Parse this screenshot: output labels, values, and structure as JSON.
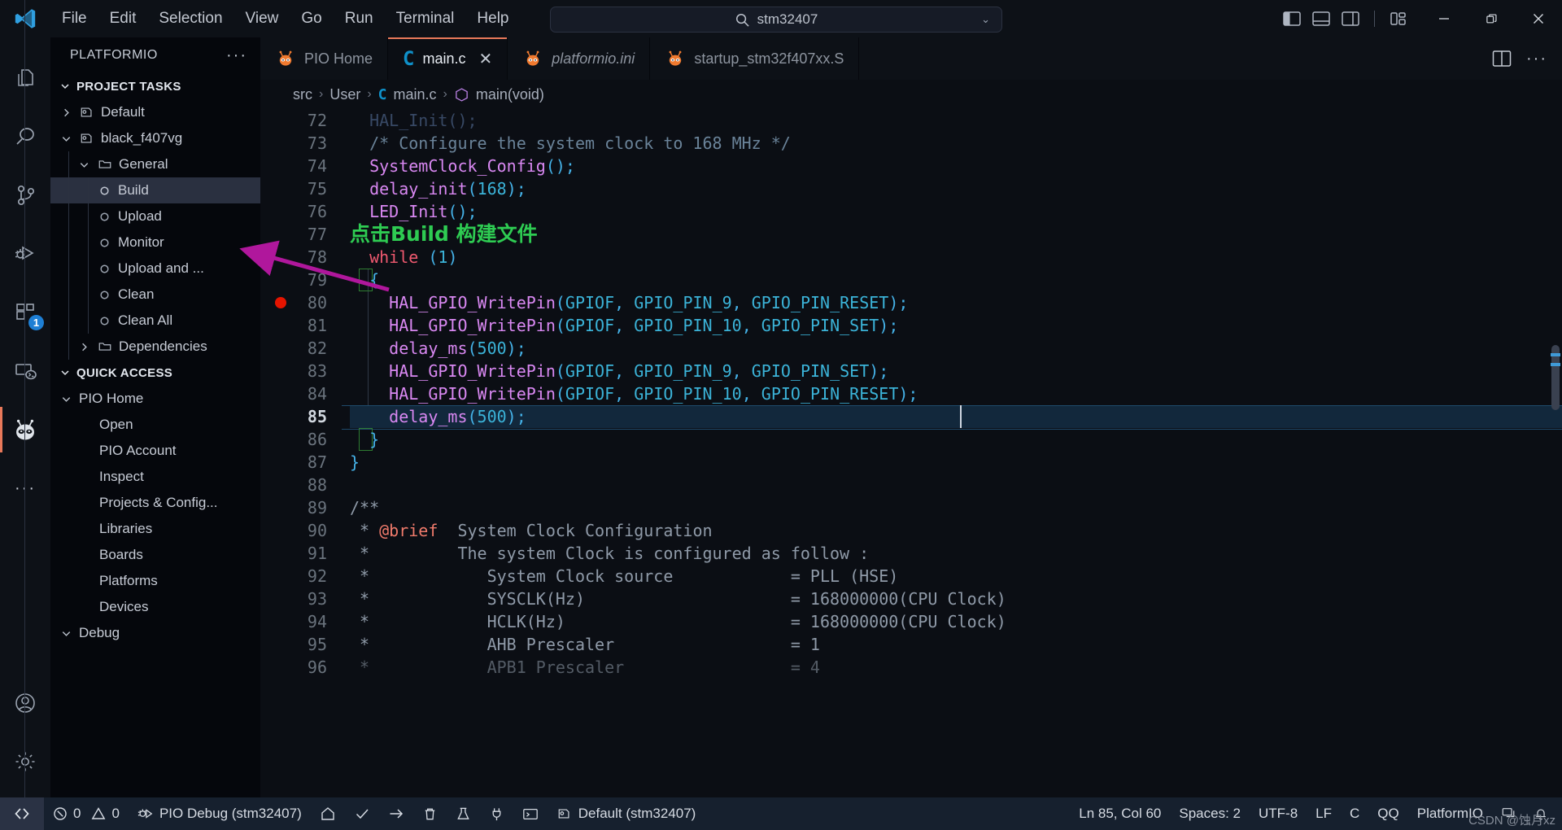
{
  "titlebar": {
    "logo": "vscode-logo",
    "menus": [
      "File",
      "Edit",
      "Selection",
      "View",
      "Go",
      "Run",
      "Terminal",
      "Help"
    ],
    "nav": {
      "back": "←",
      "forward": "→"
    },
    "command_center": {
      "value": "stm32407",
      "icon": "search-icon",
      "chevron": "⌄"
    },
    "layout_icons": [
      "toggle-primary-sidebar-icon",
      "toggle-panel-icon",
      "toggle-secondary-sidebar-icon",
      "customize-layout-icon"
    ],
    "window_controls": {
      "minimize": "—",
      "maximize": "❐",
      "close": "✕"
    }
  },
  "activitybar": {
    "items": [
      {
        "name": "explorer",
        "icon": "files-icon",
        "badge": ""
      },
      {
        "name": "search",
        "icon": "search-icon",
        "badge": ""
      },
      {
        "name": "source-control",
        "icon": "source-control-icon",
        "badge": ""
      },
      {
        "name": "run-and-debug",
        "icon": "run-debug-icon",
        "badge": ""
      },
      {
        "name": "extensions",
        "icon": "extensions-icon",
        "badge": "1"
      },
      {
        "name": "remote-explorer",
        "icon": "remote-explorer-icon",
        "badge": ""
      },
      {
        "name": "platformio",
        "icon": "platformio-alien-icon",
        "badge": "",
        "active": true
      },
      {
        "name": "more",
        "icon": "ellipsis-icon",
        "badge": ""
      }
    ],
    "bottom": [
      {
        "name": "accounts",
        "icon": "account-icon"
      },
      {
        "name": "settings",
        "icon": "gear-icon"
      }
    ]
  },
  "sidebar": {
    "title": "PLATFORMIO",
    "more_actions": "···",
    "sections": [
      {
        "title": "PROJECT TASKS",
        "expanded": true,
        "items": [
          {
            "label": "Default",
            "icon": "env-icon",
            "expanded": false,
            "level": 1
          },
          {
            "label": "black_f407vg",
            "icon": "env-icon",
            "expanded": true,
            "level": 1
          },
          {
            "label": "General",
            "icon": "folder-icon",
            "expanded": true,
            "level": 2
          },
          {
            "label": "Build",
            "icon": "task-icon",
            "level": 3,
            "selected": true
          },
          {
            "label": "Upload",
            "icon": "task-icon",
            "level": 3
          },
          {
            "label": "Monitor",
            "icon": "task-icon",
            "level": 3
          },
          {
            "label": "Upload and ...",
            "icon": "task-icon",
            "level": 3
          },
          {
            "label": "Clean",
            "icon": "task-icon",
            "level": 3
          },
          {
            "label": "Clean All",
            "icon": "task-icon",
            "level": 3
          },
          {
            "label": "Dependencies",
            "icon": "folder-icon",
            "expanded": false,
            "level": 2
          }
        ]
      },
      {
        "title": "QUICK ACCESS",
        "expanded": true,
        "group": {
          "label": "PIO Home",
          "expanded": true
        },
        "items": [
          "Open",
          "PIO Account",
          "Inspect",
          "Projects & Config...",
          "Libraries",
          "Boards",
          "Platforms",
          "Devices"
        ],
        "next_group": "Debug"
      }
    ]
  },
  "tabs": [
    {
      "label": "PIO Home",
      "icon": "platformio-alien-icon",
      "active": false,
      "italic": false
    },
    {
      "label": "main.c",
      "icon": "c-file-icon",
      "active": true,
      "italic": false,
      "close": "✕"
    },
    {
      "label": "platformio.ini",
      "icon": "platformio-alien-icon",
      "active": false,
      "italic": true
    },
    {
      "label": "startup_stm32f407xx.S",
      "icon": "platformio-alien-icon",
      "active": false,
      "italic": false
    }
  ],
  "tabs_actions": [
    "split-editor-icon",
    "more-actions-icon"
  ],
  "breadcrumb": {
    "parts": [
      "src",
      "User",
      "main.c",
      "main(void)"
    ],
    "separator": "›",
    "file_icon": "c-file-icon",
    "symbol_icon": "function-symbol-icon"
  },
  "editor": {
    "current_line": 85,
    "breakpoint_line": 80,
    "first_visible_line": 72,
    "annotation": {
      "text": "点击Build 构建文件",
      "color": "#2ecb52",
      "arrow_color": "#b0179c"
    },
    "lines": [
      {
        "n": 72,
        "partial": true,
        "tokens": [
          {
            "t": "  HAL_Init();",
            "c": "var"
          }
        ]
      },
      {
        "n": 73,
        "tokens": [
          {
            "t": "  /* Configure the system clock to 168 MHz */",
            "c": "cmt"
          }
        ]
      },
      {
        "n": 74,
        "tokens": [
          {
            "t": "  ",
            "c": ""
          },
          {
            "t": "SystemClock_Config",
            "c": "fn"
          },
          {
            "t": "();",
            "c": "punc"
          }
        ]
      },
      {
        "n": 75,
        "tokens": [
          {
            "t": "  ",
            "c": ""
          },
          {
            "t": "delay_init",
            "c": "fn"
          },
          {
            "t": "(",
            "c": "punc"
          },
          {
            "t": "168",
            "c": "num"
          },
          {
            "t": ");",
            "c": "punc"
          }
        ]
      },
      {
        "n": 76,
        "tokens": [
          {
            "t": "  ",
            "c": ""
          },
          {
            "t": "LED_Init",
            "c": "fn"
          },
          {
            "t": "();",
            "c": "punc"
          }
        ]
      },
      {
        "n": 77,
        "note": true,
        "tokens": []
      },
      {
        "n": 78,
        "tokens": [
          {
            "t": "  ",
            "c": ""
          },
          {
            "t": "while",
            "c": "kw"
          },
          {
            "t": " (",
            "c": "punc"
          },
          {
            "t": "1",
            "c": "num"
          },
          {
            "t": ")",
            "c": "punc"
          }
        ]
      },
      {
        "n": 79,
        "tokens": [
          {
            "t": "  ",
            "c": ""
          },
          {
            "t": "{",
            "c": "punc"
          }
        ]
      },
      {
        "n": 80,
        "tokens": [
          {
            "t": "    ",
            "c": ""
          },
          {
            "t": "HAL_GPIO_WritePin",
            "c": "fn"
          },
          {
            "t": "(",
            "c": "punc"
          },
          {
            "t": "GPIOF",
            "c": "cst"
          },
          {
            "t": ", ",
            "c": "punc"
          },
          {
            "t": "GPIO_PIN_9",
            "c": "cst"
          },
          {
            "t": ", ",
            "c": "punc"
          },
          {
            "t": "GPIO_PIN_RESET",
            "c": "cst"
          },
          {
            "t": ");",
            "c": "punc"
          }
        ]
      },
      {
        "n": 81,
        "tokens": [
          {
            "t": "    ",
            "c": ""
          },
          {
            "t": "HAL_GPIO_WritePin",
            "c": "fn"
          },
          {
            "t": "(",
            "c": "punc"
          },
          {
            "t": "GPIOF",
            "c": "cst"
          },
          {
            "t": ", ",
            "c": "punc"
          },
          {
            "t": "GPIO_PIN_10",
            "c": "cst"
          },
          {
            "t": ", ",
            "c": "punc"
          },
          {
            "t": "GPIO_PIN_SET",
            "c": "cst"
          },
          {
            "t": ");",
            "c": "punc"
          }
        ]
      },
      {
        "n": 82,
        "tokens": [
          {
            "t": "    ",
            "c": ""
          },
          {
            "t": "delay_ms",
            "c": "fn"
          },
          {
            "t": "(",
            "c": "punc"
          },
          {
            "t": "500",
            "c": "num"
          },
          {
            "t": ");",
            "c": "punc"
          }
        ]
      },
      {
        "n": 83,
        "tokens": [
          {
            "t": "    ",
            "c": ""
          },
          {
            "t": "HAL_GPIO_WritePin",
            "c": "fn"
          },
          {
            "t": "(",
            "c": "punc"
          },
          {
            "t": "GPIOF",
            "c": "cst"
          },
          {
            "t": ", ",
            "c": "punc"
          },
          {
            "t": "GPIO_PIN_9",
            "c": "cst"
          },
          {
            "t": ", ",
            "c": "punc"
          },
          {
            "t": "GPIO_PIN_SET",
            "c": "cst"
          },
          {
            "t": ");",
            "c": "punc"
          }
        ]
      },
      {
        "n": 84,
        "tokens": [
          {
            "t": "    ",
            "c": ""
          },
          {
            "t": "HAL_GPIO_WritePin",
            "c": "fn"
          },
          {
            "t": "(",
            "c": "punc"
          },
          {
            "t": "GPIOF",
            "c": "cst"
          },
          {
            "t": ", ",
            "c": "punc"
          },
          {
            "t": "GPIO_PIN_10",
            "c": "cst"
          },
          {
            "t": ", ",
            "c": "punc"
          },
          {
            "t": "GPIO_PIN_RESET",
            "c": "cst"
          },
          {
            "t": ");",
            "c": "punc"
          }
        ]
      },
      {
        "n": 85,
        "highlight": true,
        "tokens": [
          {
            "t": "    ",
            "c": ""
          },
          {
            "t": "delay_ms",
            "c": "fn"
          },
          {
            "t": "(",
            "c": "punc"
          },
          {
            "t": "500",
            "c": "num"
          },
          {
            "t": ");",
            "c": "punc"
          }
        ]
      },
      {
        "n": 86,
        "tokens": [
          {
            "t": "  ",
            "c": ""
          },
          {
            "t": "}",
            "c": "punc"
          }
        ]
      },
      {
        "n": 87,
        "tokens": [
          {
            "t": "}",
            "c": "punc"
          }
        ]
      },
      {
        "n": 88,
        "tokens": []
      },
      {
        "n": 89,
        "tokens": [
          {
            "t": "/**",
            "c": "doc"
          }
        ]
      },
      {
        "n": 90,
        "tokens": [
          {
            "t": " * ",
            "c": "doc"
          },
          {
            "t": "@brief",
            "c": "docbrief"
          },
          {
            "t": "  System Clock Configuration",
            "c": "doc"
          }
        ]
      },
      {
        "n": 91,
        "tokens": [
          {
            "t": " *         The system Clock is configured as follow :",
            "c": "doc"
          }
        ]
      },
      {
        "n": 92,
        "tokens": [
          {
            "t": " *            System Clock source            = PLL (HSE)",
            "c": "doc"
          }
        ]
      },
      {
        "n": 93,
        "tokens": [
          {
            "t": " *            SYSCLK(Hz)                     = 168000000(CPU Clock)",
            "c": "doc"
          }
        ]
      },
      {
        "n": 94,
        "tokens": [
          {
            "t": " *            HCLK(Hz)                       = 168000000(CPU Clock)",
            "c": "doc"
          }
        ]
      },
      {
        "n": 95,
        "tokens": [
          {
            "t": " *            AHB Prescaler                  = 1",
            "c": "doc"
          }
        ]
      },
      {
        "n": 96,
        "partial_bottom": true,
        "tokens": [
          {
            "t": " *            APB1 Prescaler                 = 4",
            "c": "doc"
          }
        ]
      }
    ]
  },
  "statusbar": {
    "remote_icon": "remote-window-icon",
    "left": [
      {
        "name": "problems",
        "icon": "error-warning-icon",
        "label": "0  0"
      },
      {
        "name": "pio-debug",
        "icon": "debug-alt-icon",
        "label": "PIO Debug (stm32407)"
      },
      {
        "name": "pio-home",
        "icon": "home-icon",
        "label": ""
      },
      {
        "name": "pio-build",
        "icon": "check-icon",
        "label": ""
      },
      {
        "name": "pio-upload",
        "icon": "arrow-right-icon",
        "label": ""
      },
      {
        "name": "pio-clean",
        "icon": "trash-icon",
        "label": ""
      },
      {
        "name": "pio-test",
        "icon": "beaker-icon",
        "label": ""
      },
      {
        "name": "pio-serial-monitor",
        "icon": "plug-icon",
        "label": ""
      },
      {
        "name": "pio-new-terminal",
        "icon": "terminal-icon",
        "label": ""
      },
      {
        "name": "pio-project-env",
        "icon": "env-icon",
        "label": "Default (stm32407)"
      }
    ],
    "right": [
      {
        "name": "cursor-position",
        "label": "Ln 85, Col 60"
      },
      {
        "name": "indentation",
        "label": "Spaces: 2"
      },
      {
        "name": "encoding",
        "label": "UTF-8"
      },
      {
        "name": "eol",
        "label": "LF"
      },
      {
        "name": "language-mode",
        "label": "C"
      },
      {
        "name": "qq-input",
        "label": "QQ"
      },
      {
        "name": "platformio-status",
        "label": "PlatformIO"
      },
      {
        "name": "notifications",
        "icon": "bell-icon",
        "label": ""
      }
    ],
    "watermark": "CSDN @蚀月xz"
  }
}
